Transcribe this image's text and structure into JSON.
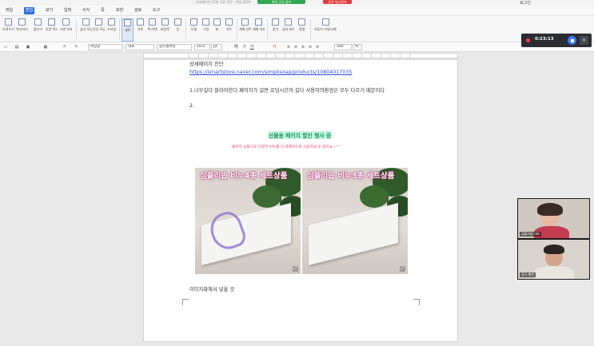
{
  "window": {
    "title": "상세페이지 15분 무료 강의 - 한글 2020",
    "recording_status_green": "화면 공유 중지",
    "recording_status_red": "공유 일시정지",
    "login": "로그인"
  },
  "menu": {
    "items": [
      "파일",
      "편집",
      "보기",
      "입력",
      "서식",
      "쪽",
      "보안",
      "검토",
      "도구"
    ],
    "active_index": 1
  },
  "ribbon": {
    "buttons": [
      {
        "label": "오려두기",
        "icon": "scissors-icon"
      },
      {
        "label": "복사하기",
        "icon": "copy-icon"
      },
      {
        "label": "붙이기",
        "icon": "paste-icon"
      },
      {
        "label": "모양 복사",
        "icon": "format-painter-icon"
      },
      {
        "label": "조판 부호 지우기",
        "icon": "eraser-icon"
      },
      {
        "label": "글자 모양",
        "icon": "char-shape-icon"
      },
      {
        "label": "문단 모양",
        "icon": "para-shape-icon"
      },
      {
        "label": "스타일",
        "icon": "style-icon"
      },
      {
        "label": "세로",
        "icon": "portrait-icon"
      },
      {
        "label": "가로",
        "icon": "landscape-icon"
      },
      {
        "label": "쪽 여백",
        "icon": "margin-icon"
      },
      {
        "label": "바탕쪽",
        "icon": "master-page-icon"
      },
      {
        "label": "단",
        "icon": "columns-icon"
      },
      {
        "label": "도형",
        "icon": "shape-icon"
      },
      {
        "label": "그림",
        "icon": "image-icon"
      },
      {
        "label": "표",
        "icon": "table-icon"
      },
      {
        "label": "차트",
        "icon": "chart-icon"
      },
      {
        "label": "개체 선택",
        "icon": "select-object-icon"
      },
      {
        "label": "개체 보호",
        "icon": "protect-object-icon"
      },
      {
        "label": "찾기",
        "icon": "find-icon"
      },
      {
        "label": "글자 바꾸기",
        "icon": "replace-icon"
      },
      {
        "label": "정렬",
        "icon": "sort-icon"
      },
      {
        "label": "유튜브 커뮤니케이터",
        "icon": "communicator-icon"
      }
    ],
    "selected_index": 8
  },
  "format": {
    "style": "바탕글",
    "font_lang": "대표",
    "font": "함초롬바탕",
    "size": "10.0",
    "size_unit": "pt",
    "line_spacing": "160",
    "line_unit": "%"
  },
  "document": {
    "heading": "상세페이지 진단",
    "link": "https://smartstore.naver.com/simplisoap/products/10804017035",
    "item1": "1.너무길다 잘라야한다.페이지가 길면 로딩시간이 길다 사용자의환경은 모두 다르기 때문이다",
    "item2": "2.",
    "banner_title": "선물용 패키지 할인 행사 중",
    "banner_subtitle": "패키지 상품으로 다양한 비누를 더 경제적으로 사용하실 수 있어요~^^",
    "photo1_title": "심플리솝 비누4종 세트상품",
    "photo2_title": "심플리솝 비누3종 세트상품",
    "footer_text": "이미지화해서 넣을 것"
  },
  "recorder": {
    "time": "0:23:13"
  },
  "participants": [
    {
      "name": "심플리솝 대표"
    },
    {
      "name": "강사 행복"
    }
  ]
}
